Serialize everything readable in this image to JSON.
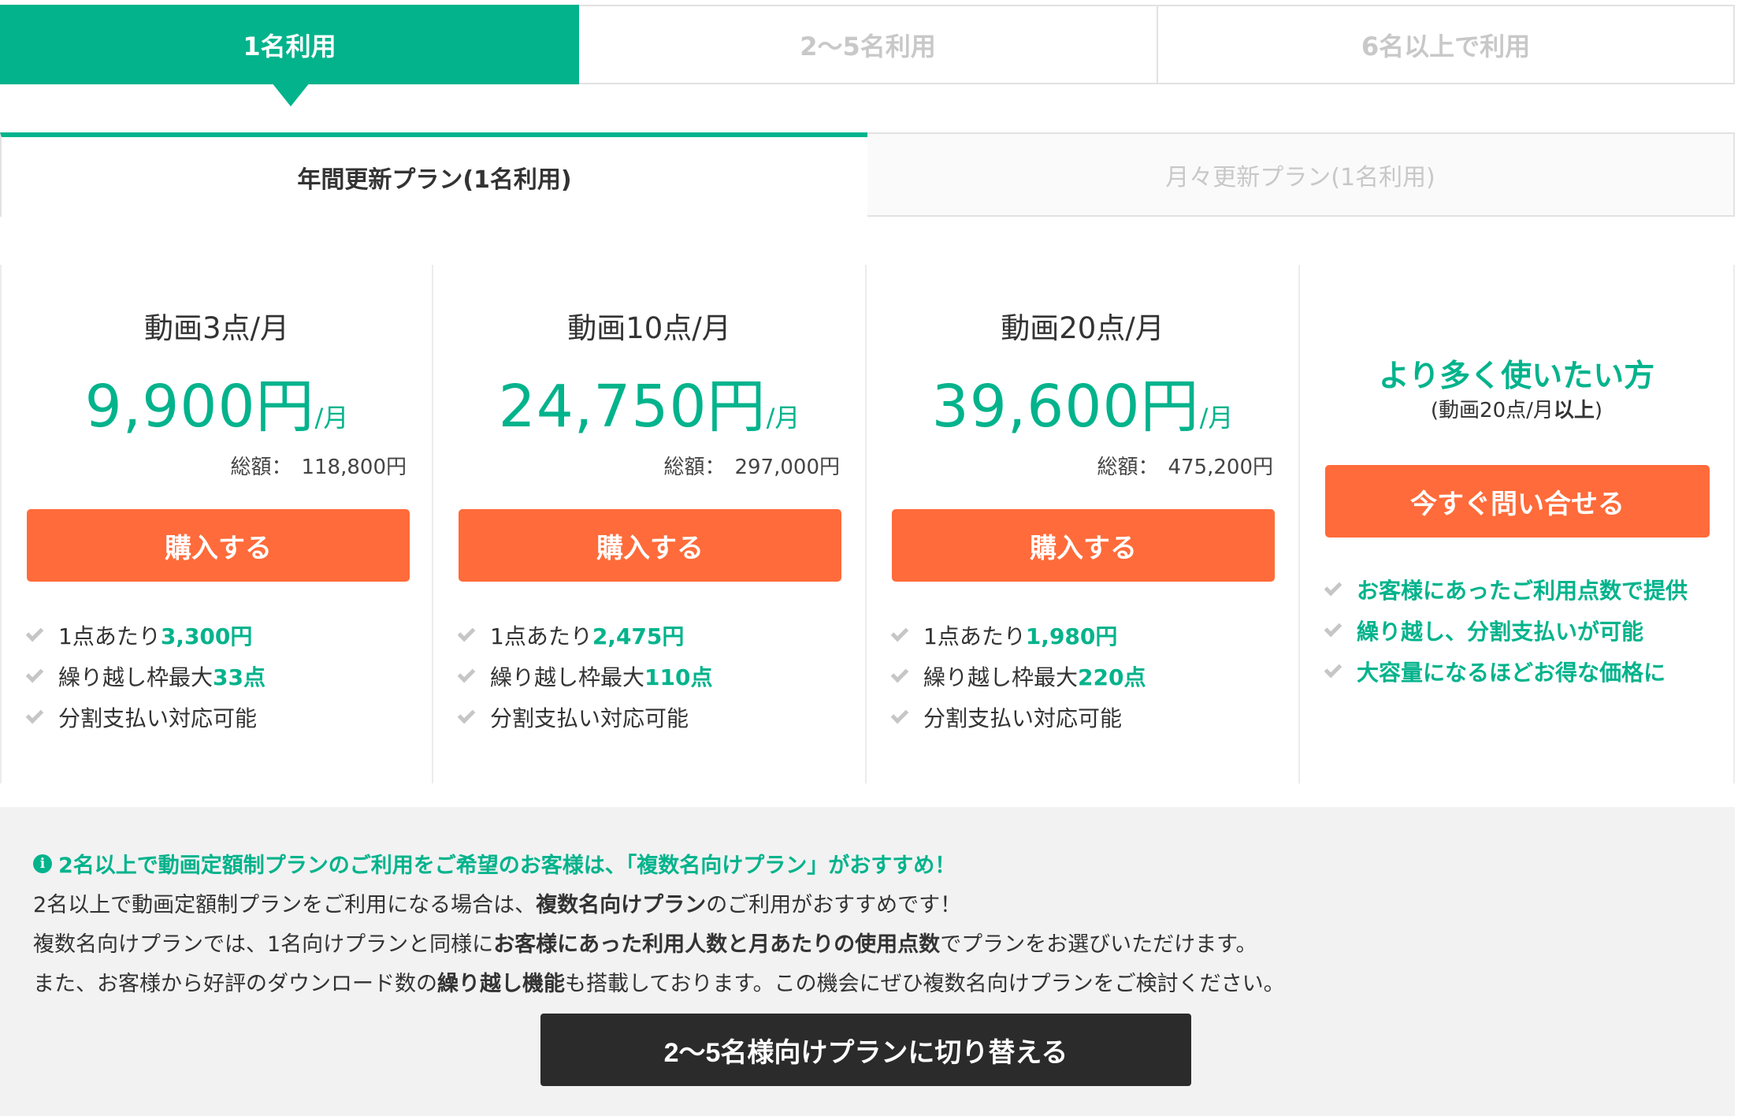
{
  "user_tabs": [
    {
      "label": "1名利用"
    },
    {
      "label": "2〜5名利用"
    },
    {
      "label": "6名以上で利用"
    }
  ],
  "renew_tabs": [
    {
      "label": "年間更新プラン(1名利用)"
    },
    {
      "label": "月々更新プラン(1名利用)"
    }
  ],
  "plans": [
    {
      "name": "動画3点/月",
      "price": "9,900円",
      "unit": "/月",
      "total_label": "総額：",
      "total": "118,800円",
      "button": "購入する",
      "features": [
        {
          "text": "1点あたり",
          "highlight": "3,300円"
        },
        {
          "text": "繰り越し枠最大",
          "highlight": "33点"
        },
        {
          "text": "分割支払い対応可能",
          "highlight": ""
        }
      ]
    },
    {
      "name": "動画10点/月",
      "price": "24,750円",
      "unit": "/月",
      "total_label": "総額：",
      "total": "297,000円",
      "button": "購入する",
      "features": [
        {
          "text": "1点あたり",
          "highlight": "2,475円"
        },
        {
          "text": "繰り越し枠最大",
          "highlight": "110点"
        },
        {
          "text": "分割支払い対応可能",
          "highlight": ""
        }
      ]
    },
    {
      "name": "動画20点/月",
      "price": "39,600円",
      "unit": "/月",
      "total_label": "総額：",
      "total": "475,200円",
      "button": "購入する",
      "features": [
        {
          "text": "1点あたり",
          "highlight": "1,980円"
        },
        {
          "text": "繰り越し枠最大",
          "highlight": "220点"
        },
        {
          "text": "分割支払い対応可能",
          "highlight": ""
        }
      ]
    }
  ],
  "contact": {
    "title": "より多く使いたい方",
    "sub_prefix": "(動画20点/月",
    "sub_bold": "以上",
    "sub_suffix": ")",
    "button": "今すぐ問い合せる",
    "features": [
      "お客様にあったご利用点数で提供",
      "繰り越し、分割支払いが可能",
      "大容量になるほどお得な価格に"
    ]
  },
  "info": {
    "icon": "i",
    "title": "2名以上で動画定額制プランのご利用をご希望のお客様は、「複数名向けプラン」がおすすめ！",
    "line1_a": "2名以上で動画定額制プランをご利用になる場合は、",
    "line1_b": "複数名向けプラン",
    "line1_c": "のご利用がおすすめです！",
    "line2_a": "複数名向けプランでは、1名向けプランと同様に",
    "line2_b": "お客様にあった利用人数と月あたりの使用点数",
    "line2_c": "でプランをお選びいただけます。",
    "line3_a": "また、お客様から好評のダウンロード数の",
    "line3_b": "繰り越し機能",
    "line3_c": "も搭載しております。この機会にぜひ複数名向けプランをご検討ください。",
    "button": "2〜5名様向けプランに切り替える"
  },
  "colors": {
    "accent": "#02b38c",
    "cta": "#ff6b3a",
    "dark_button": "#2b2b2b",
    "info_bg": "#f2f2f2"
  }
}
